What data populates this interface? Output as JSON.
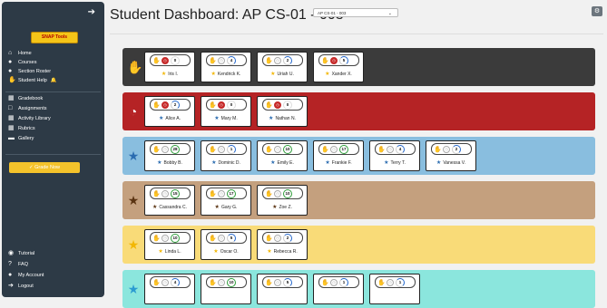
{
  "app": {
    "title": "Student Dashboard: AP CS-01 - 003",
    "logo": "SNAP Tools",
    "section_select": "AP CS-01 - 003"
  },
  "nav_top": [
    {
      "label": "Home"
    },
    {
      "label": "Courses"
    },
    {
      "label": "Section Roster"
    },
    {
      "label": "Student Help"
    }
  ],
  "nav_mid": [
    {
      "label": "Gradebook"
    },
    {
      "label": "Assignments"
    },
    {
      "label": "Activity Library"
    },
    {
      "label": "Rubrics"
    },
    {
      "label": "Gallery"
    }
  ],
  "grade_now": "Grade Now",
  "nav_bottom": [
    {
      "label": "Tutorial"
    },
    {
      "label": "FAQ"
    },
    {
      "label": "My Account"
    },
    {
      "label": "Logout"
    }
  ],
  "colors": {
    "black": "#3b3b3b",
    "red": "#b52325",
    "blue": "#89bedf",
    "brown": "#c4a07e",
    "yellow": "#f9db78",
    "cyan": "#8be6dd"
  },
  "rows": [
    {
      "group": "raised-hand",
      "students": [
        {
          "name": "Iris I.",
          "hand": true,
          "clock_red": true,
          "count": "0",
          "ring": "dark"
        },
        {
          "name": "Kendrick K.",
          "hand": true,
          "clock_red": false,
          "count": "4",
          "ring": "blue"
        },
        {
          "name": "Uriah U.",
          "hand": true,
          "clock_red": false,
          "count": "2",
          "ring": "blue"
        },
        {
          "name": "Xander X.",
          "hand": true,
          "clock_red": true,
          "count": "5",
          "ring": "blue"
        }
      ]
    },
    {
      "group": "clock",
      "students": [
        {
          "name": "Alice A.",
          "hand": false,
          "clock_red": true,
          "count": "2",
          "ring": "blue"
        },
        {
          "name": "Mary M.",
          "hand": false,
          "clock_red": true,
          "count": "0",
          "ring": "dark"
        },
        {
          "name": "Nathan N.",
          "hand": false,
          "clock_red": true,
          "count": "0",
          "ring": "dark"
        }
      ]
    },
    {
      "group": "blue-star",
      "students": [
        {
          "name": "Bobby B.",
          "count": "28",
          "ring": "green"
        },
        {
          "name": "Dominic D.",
          "count": "1",
          "ring": "blue"
        },
        {
          "name": "Emily E.",
          "count": "10",
          "ring": "green"
        },
        {
          "name": "Frankie F.",
          "count": "17",
          "ring": "green"
        },
        {
          "name": "Terry T.",
          "count": "4",
          "ring": "blue"
        },
        {
          "name": "Vanessa V.",
          "count": "2",
          "ring": "blue"
        }
      ]
    },
    {
      "group": "brown-star",
      "students": [
        {
          "name": "Cassandra C.",
          "count": "15",
          "ring": "green"
        },
        {
          "name": "Gary G.",
          "count": "17",
          "ring": "green"
        },
        {
          "name": "Zoe Z.",
          "count": "10",
          "ring": "green"
        }
      ]
    },
    {
      "group": "yellow-star",
      "students": [
        {
          "name": "Linda L.",
          "count": "10",
          "ring": "green"
        },
        {
          "name": "Oscar O.",
          "count": "5",
          "ring": "blue"
        },
        {
          "name": "Rebecca R.",
          "count": "2",
          "ring": "blue"
        }
      ]
    },
    {
      "group": "cyan-star",
      "students": [
        {
          "count": "4",
          "ring": "blue"
        },
        {
          "count": "10",
          "ring": "green"
        },
        {
          "count": "5",
          "ring": "blue"
        },
        {
          "count": "1",
          "ring": "blue"
        },
        {
          "count": "1",
          "ring": "blue"
        }
      ]
    }
  ]
}
